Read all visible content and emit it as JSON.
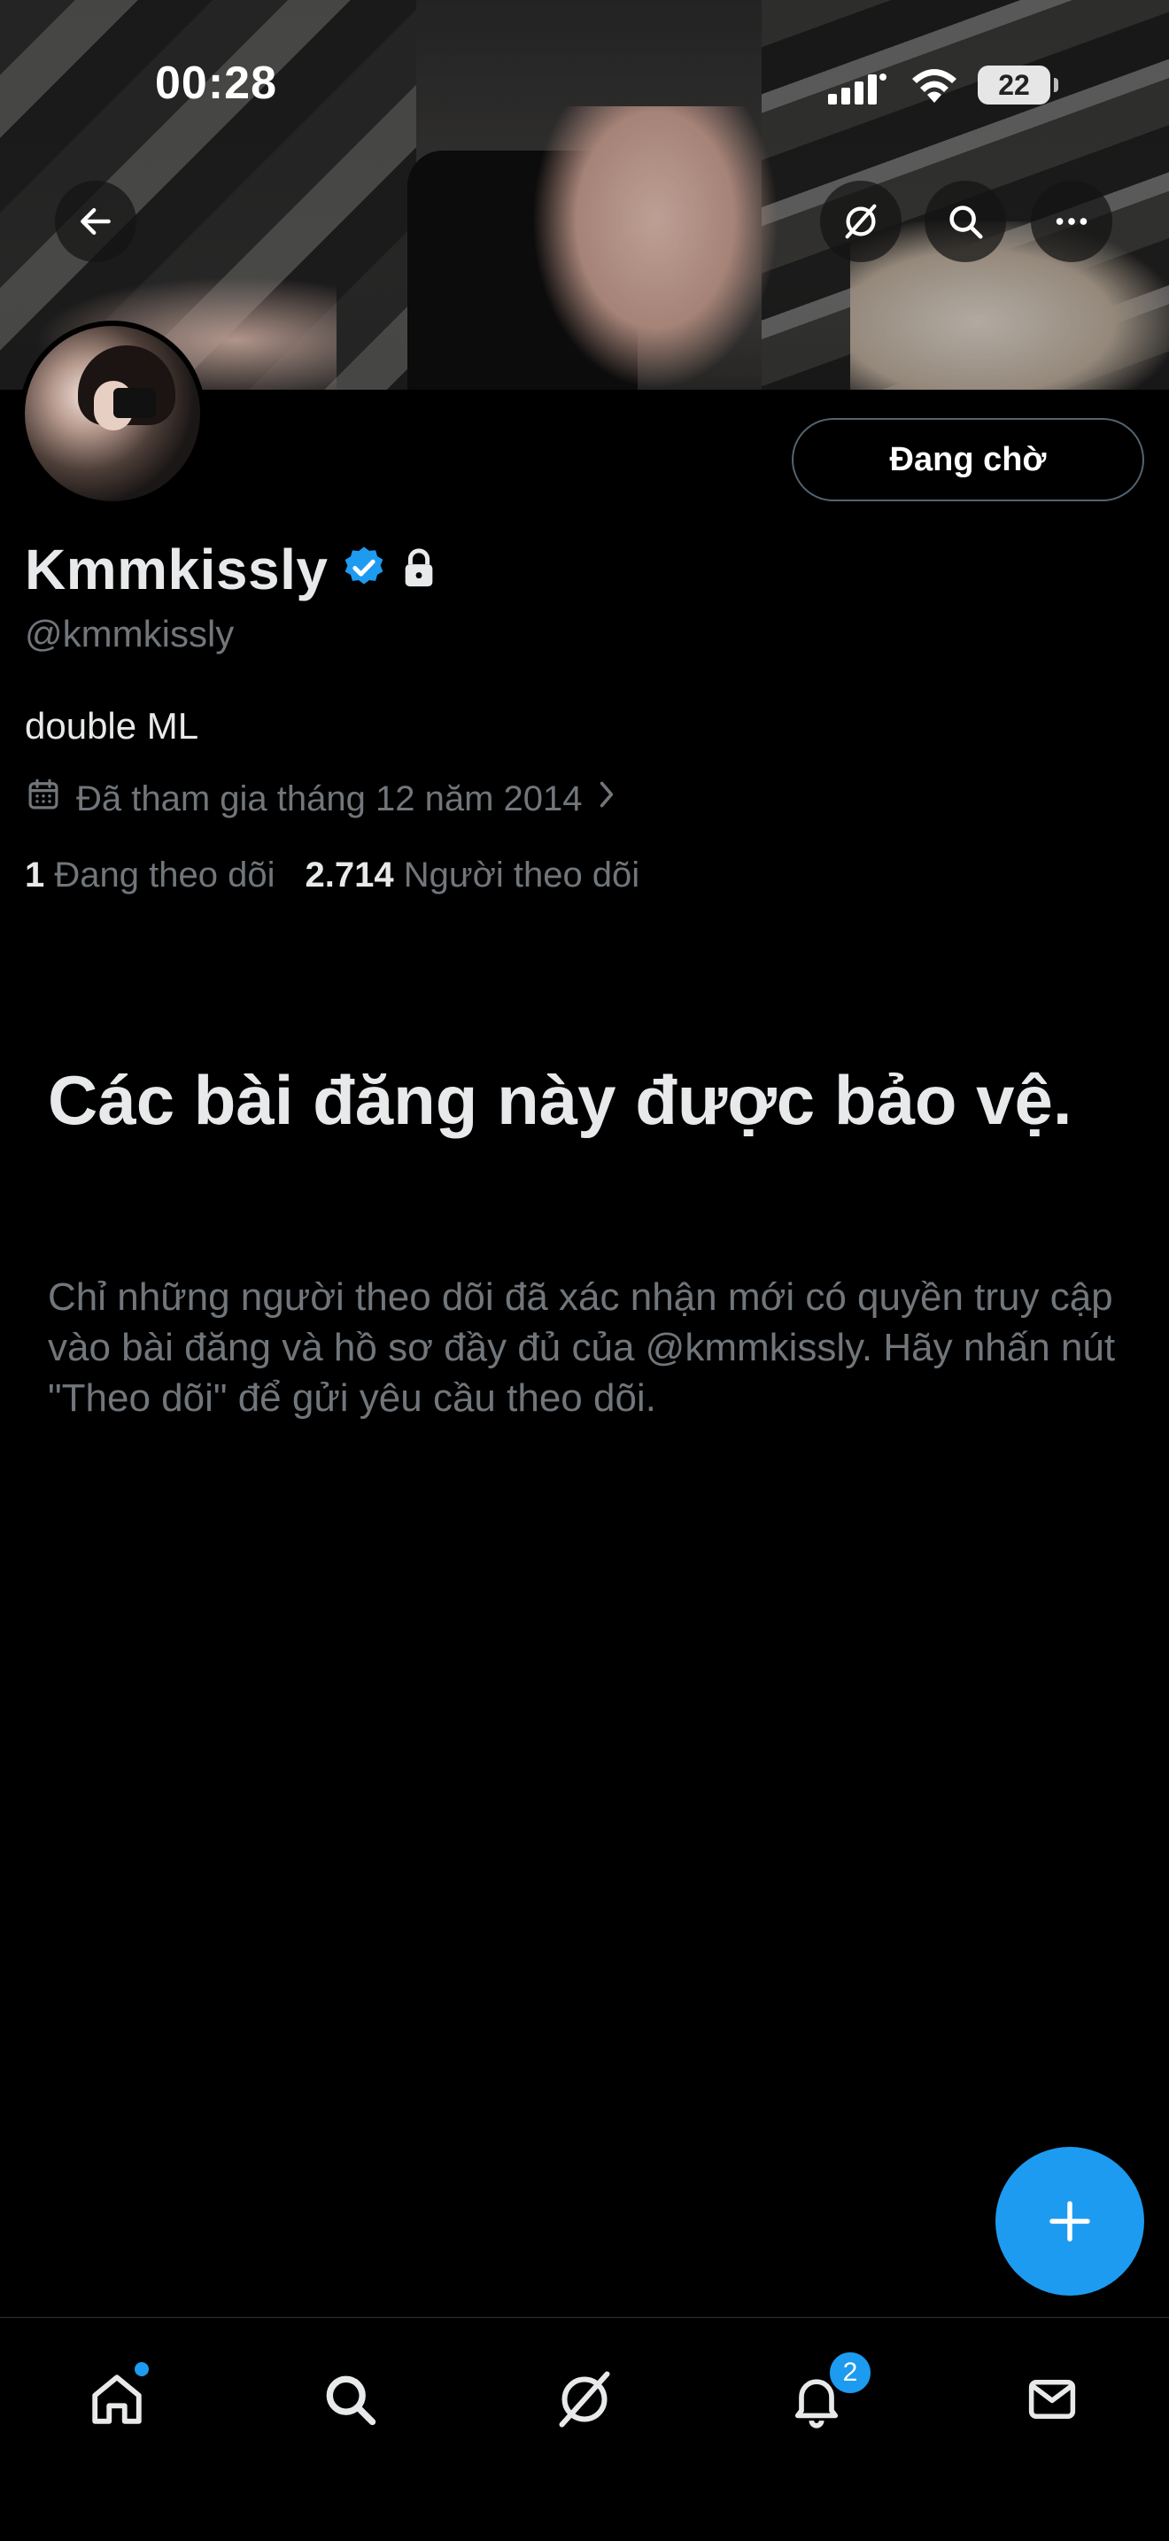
{
  "status_bar": {
    "time": "00:28",
    "battery": "22"
  },
  "header": {
    "back_icon": "arrow-left-icon",
    "grok_icon": "grok-icon",
    "search_icon": "search-icon",
    "more_icon": "more-horizontal-icon"
  },
  "profile": {
    "display_name": "Kmmkissly",
    "handle": "@kmmkissly",
    "bio": "double ML",
    "joined": "Đã tham gia tháng 12 năm 2014",
    "following_count": "1",
    "following_label": "Đang theo dõi",
    "followers_count": "2.714",
    "followers_label": "Người theo dõi",
    "pending_button": "Đang chờ",
    "verified": true,
    "protected": true
  },
  "protected_notice": {
    "title": "Các bài đăng này được bảo vệ.",
    "body": "Chỉ những người theo dõi đã xác nhận mới có quyền truy cập vào bài đăng và hồ sơ đầy đủ của @kmmkissly. Hãy nhấn nút \"Theo dõi\" để gửi yêu cầu theo dõi."
  },
  "tabbar": {
    "items": [
      "home-icon",
      "search-icon",
      "grok-icon",
      "notifications-icon",
      "messages-icon"
    ],
    "notifications_badge": "2"
  },
  "colors": {
    "accent": "#1d9bf0",
    "background": "#000000",
    "secondary_text": "#71767b"
  }
}
